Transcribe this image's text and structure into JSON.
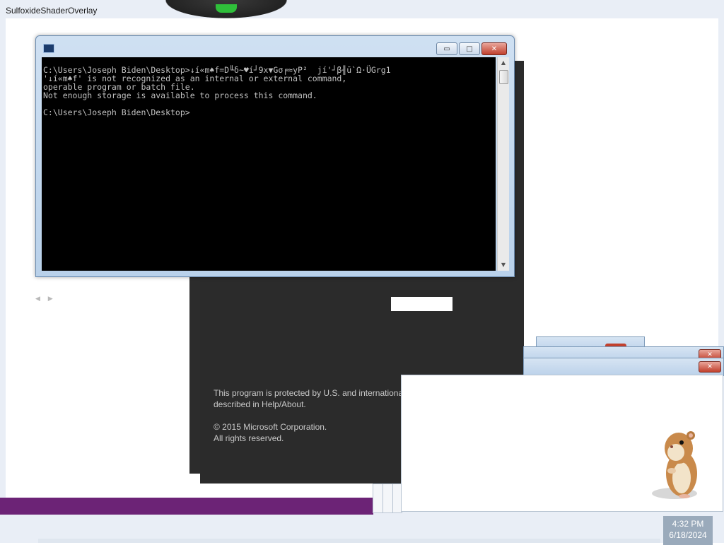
{
  "overlay": {
    "title": "SulfoxideShaderOverlay"
  },
  "console": {
    "lines": [
      "C:\\Users\\Joseph Biden\\Desktop>↓í«m♠f=D╙δ~♥í┘9x▼Gσ╒≈yP²  jí'┘β╢ü`Ω·ÜGrg1",
      "'↓í«m♠f' is not recognized as an internal or external command,",
      "operable program or batch file.",
      "Not enough storage is available to process this command.",
      "",
      "C:\\Users\\Joseph Biden\\Desktop>"
    ],
    "buttons": {
      "minimize": "▭",
      "maximize": "□",
      "close": "✕"
    }
  },
  "copyright": {
    "notice": "This program is protected by U.S. and international copyright laws as described in Help/About.",
    "corp": "© 2015 Microsoft Corporation.",
    "rights": "All rights reserved."
  },
  "clock": {
    "time": "4:32 PM",
    "date": "6/18/2024"
  },
  "colors": {
    "purple_bar": "#6c2376",
    "console_bg": "#000000",
    "dark_panel": "#2b2b2b",
    "close_red": "#c1402d"
  }
}
